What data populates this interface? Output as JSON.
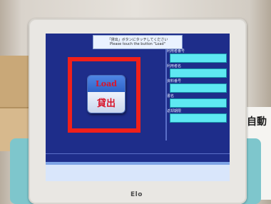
{
  "banner": {
    "line1": "「貸出」ボタンにタッチしてください",
    "line2": "Please touch the button \"Load\""
  },
  "load_button": {
    "en_label": "Load",
    "jp_label": "貸出"
  },
  "fields": [
    {
      "label": "利用者番号"
    },
    {
      "label": "利用者名"
    },
    {
      "label": "資料番号"
    },
    {
      "label": "書名"
    },
    {
      "label": "返却期限"
    }
  ],
  "monitor": {
    "brand": "Elo"
  },
  "background_sign": {
    "text": "自動"
  },
  "colors": {
    "screen_bg": "#1e2d8a",
    "field_fill": "#5ee8f2",
    "highlight": "#f0201a",
    "load_text": "#d8152b"
  }
}
